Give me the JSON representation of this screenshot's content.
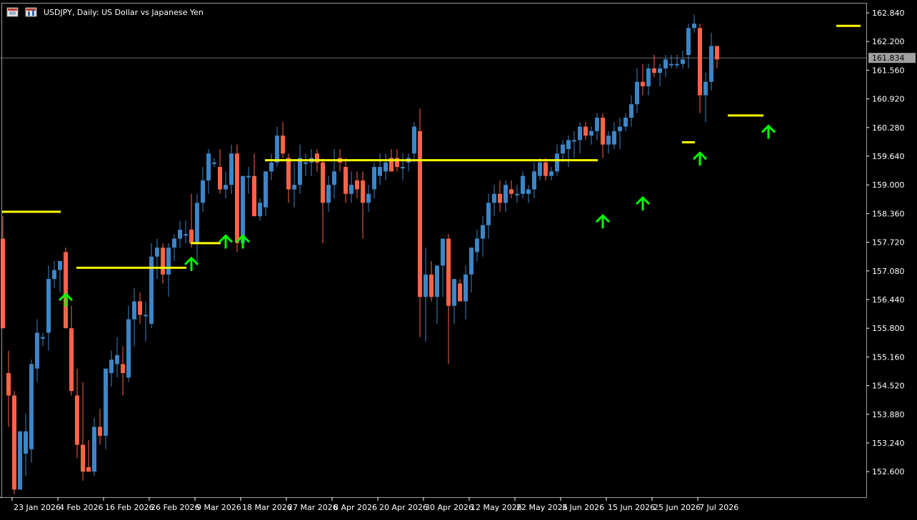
{
  "window": {
    "title": "USDJPY, Daily:  US Dollar vs Japanese Yen"
  },
  "colors": {
    "background": "#000000",
    "bull": "#3d85c6",
    "bear": "#ff6347",
    "level_line": "#ffff00",
    "signal_arrow": "#00ff00",
    "price_line": "#6b6b6b",
    "price_label_bg": "#a0a0a0",
    "axis": "#ffffff"
  },
  "icons": [
    "chart-menu-icon",
    "symbol-properties-icon",
    "up-arrow-icon"
  ],
  "chart_data": {
    "type": "candlestick",
    "symbol": "USDJPY",
    "timeframe": "Daily",
    "description": "US Dollar vs Japanese Yen",
    "current_price": "161.834",
    "ylim": [
      152.1,
      163.0
    ],
    "y_ticks": [
      "162.840",
      "162.200",
      "161.560",
      "160.920",
      "160.280",
      "159.640",
      "159.000",
      "158.360",
      "157.720",
      "157.080",
      "156.440",
      "155.800",
      "155.160",
      "154.520",
      "153.880",
      "153.240",
      "152.600"
    ],
    "x_ticks": [
      "23 Jan 2026",
      "4 Feb 2026",
      "16 Feb 2026",
      "26 Feb 2026",
      "9 Mar 2026",
      "18 Mar 2026",
      "27 Mar 2026",
      "8 Apr 2026",
      "20 Apr 2026",
      "30 Apr 2026",
      "12 May 2026",
      "22 May 2026",
      "3 Jun 2026",
      "15 Jun 2026",
      "25 Jun 2026",
      "7 Jul 2026"
    ],
    "x_tick_bars": [
      2,
      10,
      18,
      26,
      34,
      42,
      50,
      58,
      66,
      74,
      82,
      90,
      98,
      106,
      114,
      122
    ],
    "candles": [
      {
        "o": 157.8,
        "h": 158.3,
        "l": 155.8,
        "c": 155.8
      },
      {
        "o": 154.8,
        "h": 155.3,
        "l": 153.6,
        "c": 154.3
      },
      {
        "o": 154.3,
        "h": 154.4,
        "l": 152.1,
        "c": 152.2
      },
      {
        "o": 152.2,
        "h": 153.5,
        "l": 152.2,
        "c": 153.5
      },
      {
        "o": 153.0,
        "h": 153.9,
        "l": 152.5,
        "c": 153.5
      },
      {
        "o": 153.1,
        "h": 155.1,
        "l": 152.8,
        "c": 155.0
      },
      {
        "o": 154.9,
        "h": 156.0,
        "l": 154.6,
        "c": 155.7
      },
      {
        "o": 155.6,
        "h": 155.7,
        "l": 155.4,
        "c": 155.6
      },
      {
        "o": 155.7,
        "h": 157.2,
        "l": 155.3,
        "c": 156.9
      },
      {
        "o": 156.9,
        "h": 157.3,
        "l": 156.7,
        "c": 157.1
      },
      {
        "o": 157.1,
        "h": 157.3,
        "l": 156.6,
        "c": 157.3
      },
      {
        "o": 157.5,
        "h": 157.6,
        "l": 155.8,
        "c": 155.8
      },
      {
        "o": 155.8,
        "h": 156.3,
        "l": 154.3,
        "c": 154.4
      },
      {
        "o": 154.3,
        "h": 154.9,
        "l": 152.9,
        "c": 153.2
      },
      {
        "o": 153.2,
        "h": 154.6,
        "l": 152.4,
        "c": 152.6
      },
      {
        "o": 152.7,
        "h": 153.3,
        "l": 152.6,
        "c": 152.6
      },
      {
        "o": 152.6,
        "h": 153.8,
        "l": 152.5,
        "c": 153.6
      },
      {
        "o": 153.6,
        "h": 154.0,
        "l": 153.2,
        "c": 153.4
      },
      {
        "o": 153.4,
        "h": 154.8,
        "l": 153.1,
        "c": 154.9
      },
      {
        "o": 154.8,
        "h": 155.3,
        "l": 154.5,
        "c": 155.1
      },
      {
        "o": 155.0,
        "h": 155.6,
        "l": 154.7,
        "c": 155.2
      },
      {
        "o": 155.0,
        "h": 155.4,
        "l": 154.3,
        "c": 154.8
      },
      {
        "o": 154.7,
        "h": 156.3,
        "l": 154.6,
        "c": 156.0
      },
      {
        "o": 156.0,
        "h": 156.7,
        "l": 155.4,
        "c": 156.4
      },
      {
        "o": 156.4,
        "h": 156.6,
        "l": 155.9,
        "c": 156.1
      },
      {
        "o": 156.1,
        "h": 156.4,
        "l": 155.5,
        "c": 156.1
      },
      {
        "o": 155.9,
        "h": 157.7,
        "l": 155.8,
        "c": 157.4
      },
      {
        "o": 157.4,
        "h": 157.8,
        "l": 156.9,
        "c": 157.6
      },
      {
        "o": 157.6,
        "h": 157.7,
        "l": 156.8,
        "c": 157.0
      },
      {
        "o": 157.0,
        "h": 157.7,
        "l": 156.5,
        "c": 157.6
      },
      {
        "o": 157.6,
        "h": 157.9,
        "l": 157.3,
        "c": 157.8
      },
      {
        "o": 157.8,
        "h": 158.2,
        "l": 157.6,
        "c": 158.0
      },
      {
        "o": 157.9,
        "h": 158.2,
        "l": 157.7,
        "c": 157.9
      },
      {
        "o": 158.0,
        "h": 158.8,
        "l": 157.6,
        "c": 157.7
      },
      {
        "o": 157.7,
        "h": 158.8,
        "l": 157.2,
        "c": 158.6
      },
      {
        "o": 158.6,
        "h": 159.4,
        "l": 158.4,
        "c": 159.1
      },
      {
        "o": 159.1,
        "h": 159.8,
        "l": 158.8,
        "c": 159.7
      },
      {
        "o": 159.5,
        "h": 159.6,
        "l": 159.4,
        "c": 159.5
      },
      {
        "o": 159.4,
        "h": 159.8,
        "l": 158.8,
        "c": 158.9
      },
      {
        "o": 158.9,
        "h": 159.3,
        "l": 158.7,
        "c": 159.0
      },
      {
        "o": 159.0,
        "h": 159.9,
        "l": 158.8,
        "c": 159.7
      },
      {
        "o": 159.7,
        "h": 159.9,
        "l": 157.5,
        "c": 157.7
      },
      {
        "o": 157.7,
        "h": 159.1,
        "l": 157.6,
        "c": 159.2
      },
      {
        "o": 159.2,
        "h": 159.4,
        "l": 158.8,
        "c": 159.2
      },
      {
        "o": 159.2,
        "h": 159.7,
        "l": 158.5,
        "c": 158.3
      },
      {
        "o": 158.3,
        "h": 158.7,
        "l": 158.2,
        "c": 158.6
      },
      {
        "o": 158.5,
        "h": 159.3,
        "l": 158.3,
        "c": 159.3
      },
      {
        "o": 159.3,
        "h": 159.7,
        "l": 159.1,
        "c": 159.5
      },
      {
        "o": 159.5,
        "h": 160.3,
        "l": 159.4,
        "c": 160.1
      },
      {
        "o": 160.1,
        "h": 160.4,
        "l": 159.6,
        "c": 159.7
      },
      {
        "o": 159.6,
        "h": 159.7,
        "l": 158.6,
        "c": 158.9
      },
      {
        "o": 158.9,
        "h": 159.5,
        "l": 158.5,
        "c": 159.0
      },
      {
        "o": 159.0,
        "h": 159.9,
        "l": 158.8,
        "c": 159.6
      },
      {
        "o": 159.5,
        "h": 159.7,
        "l": 159.2,
        "c": 159.5
      },
      {
        "o": 159.5,
        "h": 159.8,
        "l": 159.2,
        "c": 159.6
      },
      {
        "o": 159.7,
        "h": 159.8,
        "l": 159.3,
        "c": 159.5
      },
      {
        "o": 159.5,
        "h": 159.6,
        "l": 157.7,
        "c": 158.6
      },
      {
        "o": 158.6,
        "h": 159.2,
        "l": 158.4,
        "c": 159.0
      },
      {
        "o": 159.0,
        "h": 159.8,
        "l": 158.7,
        "c": 159.3
      },
      {
        "o": 159.6,
        "h": 159.8,
        "l": 159.3,
        "c": 159.5
      },
      {
        "o": 159.4,
        "h": 159.6,
        "l": 158.6,
        "c": 158.8
      },
      {
        "o": 158.8,
        "h": 159.3,
        "l": 158.6,
        "c": 159.0
      },
      {
        "o": 159.1,
        "h": 159.3,
        "l": 158.7,
        "c": 158.9
      },
      {
        "o": 159.1,
        "h": 159.3,
        "l": 157.8,
        "c": 158.6
      },
      {
        "o": 158.6,
        "h": 159.0,
        "l": 158.4,
        "c": 158.8
      },
      {
        "o": 158.9,
        "h": 159.5,
        "l": 158.7,
        "c": 159.4
      },
      {
        "o": 159.2,
        "h": 159.7,
        "l": 159.0,
        "c": 159.4
      },
      {
        "o": 159.3,
        "h": 159.7,
        "l": 159.1,
        "c": 159.5
      },
      {
        "o": 159.6,
        "h": 159.8,
        "l": 159.3,
        "c": 159.3
      },
      {
        "o": 159.6,
        "h": 159.8,
        "l": 159.3,
        "c": 159.4
      },
      {
        "o": 159.4,
        "h": 159.7,
        "l": 159.1,
        "c": 159.4
      },
      {
        "o": 159.5,
        "h": 159.7,
        "l": 159.3,
        "c": 159.6
      },
      {
        "o": 159.7,
        "h": 160.4,
        "l": 159.5,
        "c": 160.3
      },
      {
        "o": 160.2,
        "h": 160.7,
        "l": 155.6,
        "c": 156.5
      },
      {
        "o": 156.5,
        "h": 157.6,
        "l": 155.5,
        "c": 157.0
      },
      {
        "o": 157.0,
        "h": 157.3,
        "l": 156.4,
        "c": 156.5
      },
      {
        "o": 156.5,
        "h": 156.8,
        "l": 155.9,
        "c": 157.2
      },
      {
        "o": 157.2,
        "h": 157.4,
        "l": 156.5,
        "c": 157.8
      },
      {
        "o": 157.8,
        "h": 157.9,
        "l": 155.0,
        "c": 156.3
      },
      {
        "o": 156.3,
        "h": 156.9,
        "l": 155.9,
        "c": 156.9
      },
      {
        "o": 156.8,
        "h": 156.9,
        "l": 156.4,
        "c": 156.4
      },
      {
        "o": 156.4,
        "h": 157.2,
        "l": 156.0,
        "c": 157.0
      },
      {
        "o": 157.0,
        "h": 157.3,
        "l": 156.6,
        "c": 157.6
      },
      {
        "o": 157.5,
        "h": 158.0,
        "l": 157.3,
        "c": 157.8
      },
      {
        "o": 157.8,
        "h": 158.3,
        "l": 157.4,
        "c": 158.1
      },
      {
        "o": 158.1,
        "h": 158.8,
        "l": 157.8,
        "c": 158.6
      },
      {
        "o": 158.6,
        "h": 159.0,
        "l": 158.3,
        "c": 158.8
      },
      {
        "o": 158.8,
        "h": 159.1,
        "l": 158.4,
        "c": 158.6
      },
      {
        "o": 158.6,
        "h": 159.1,
        "l": 158.4,
        "c": 159.0
      },
      {
        "o": 158.9,
        "h": 159.1,
        "l": 158.7,
        "c": 158.8
      },
      {
        "o": 158.8,
        "h": 159.0,
        "l": 158.6,
        "c": 158.8
      },
      {
        "o": 158.8,
        "h": 159.3,
        "l": 158.7,
        "c": 159.2
      },
      {
        "o": 158.8,
        "h": 159.0,
        "l": 158.6,
        "c": 158.9
      },
      {
        "o": 158.9,
        "h": 159.5,
        "l": 158.7,
        "c": 159.3
      },
      {
        "o": 159.2,
        "h": 159.6,
        "l": 159.1,
        "c": 159.5
      },
      {
        "o": 159.5,
        "h": 159.6,
        "l": 159.1,
        "c": 159.2
      },
      {
        "o": 159.2,
        "h": 159.4,
        "l": 159.1,
        "c": 159.3
      },
      {
        "o": 159.3,
        "h": 159.9,
        "l": 159.2,
        "c": 159.7
      },
      {
        "o": 159.7,
        "h": 160.0,
        "l": 159.5,
        "c": 159.9
      },
      {
        "o": 159.8,
        "h": 160.1,
        "l": 159.4,
        "c": 160.0
      },
      {
        "o": 160.0,
        "h": 160.2,
        "l": 159.6,
        "c": 160.0
      },
      {
        "o": 160.0,
        "h": 160.4,
        "l": 159.7,
        "c": 160.3
      },
      {
        "o": 160.3,
        "h": 160.4,
        "l": 160.0,
        "c": 160.1
      },
      {
        "o": 160.1,
        "h": 160.3,
        "l": 159.9,
        "c": 160.2
      },
      {
        "o": 160.2,
        "h": 160.6,
        "l": 160.0,
        "c": 160.5
      },
      {
        "o": 160.5,
        "h": 160.6,
        "l": 159.6,
        "c": 159.9
      },
      {
        "o": 159.9,
        "h": 160.2,
        "l": 159.7,
        "c": 160.1
      },
      {
        "o": 159.9,
        "h": 160.4,
        "l": 159.8,
        "c": 160.2
      },
      {
        "o": 160.2,
        "h": 160.5,
        "l": 159.8,
        "c": 160.3
      },
      {
        "o": 160.3,
        "h": 160.6,
        "l": 160.2,
        "c": 160.5
      },
      {
        "o": 160.5,
        "h": 161.0,
        "l": 160.3,
        "c": 160.8
      },
      {
        "o": 160.8,
        "h": 161.6,
        "l": 160.6,
        "c": 161.3
      },
      {
        "o": 161.3,
        "h": 161.7,
        "l": 161.0,
        "c": 161.2
      },
      {
        "o": 161.2,
        "h": 161.7,
        "l": 161.0,
        "c": 161.6
      },
      {
        "o": 161.6,
        "h": 161.9,
        "l": 161.4,
        "c": 161.5
      },
      {
        "o": 161.5,
        "h": 161.7,
        "l": 161.2,
        "c": 161.6
      },
      {
        "o": 161.6,
        "h": 161.9,
        "l": 161.4,
        "c": 161.8
      },
      {
        "o": 161.7,
        "h": 161.9,
        "l": 161.6,
        "c": 161.7
      },
      {
        "o": 161.7,
        "h": 161.9,
        "l": 161.6,
        "c": 161.7
      },
      {
        "o": 161.7,
        "h": 162.0,
        "l": 161.6,
        "c": 161.8
      },
      {
        "o": 161.9,
        "h": 162.6,
        "l": 161.6,
        "c": 162.5
      },
      {
        "o": 162.5,
        "h": 162.8,
        "l": 162.4,
        "c": 162.6
      },
      {
        "o": 162.5,
        "h": 162.6,
        "l": 160.6,
        "c": 161.0
      },
      {
        "o": 161.0,
        "h": 161.5,
        "l": 160.4,
        "c": 161.3
      },
      {
        "o": 161.3,
        "h": 162.4,
        "l": 161.1,
        "c": 162.1
      },
      {
        "o": 162.1,
        "h": 162.1,
        "l": 161.6,
        "c": 161.8
      }
    ],
    "levels": [
      {
        "price": 158.4,
        "from": 0,
        "to": 10
      },
      {
        "price": 157.15,
        "from": 13,
        "to": 32
      },
      {
        "price": 157.7,
        "from": 33,
        "to": 38
      },
      {
        "price": 159.55,
        "from": 46,
        "to": 104
      },
      {
        "price": 159.95,
        "from": 119,
        "to": 121
      },
      {
        "price": 160.55,
        "from": 127,
        "to": 133
      },
      {
        "price": 162.55,
        "from": 146,
        "to": 150
      }
    ],
    "up_arrows": [
      {
        "bar": 11,
        "price": 156.55
      },
      {
        "bar": 33,
        "price": 157.35
      },
      {
        "bar": 39,
        "price": 157.85
      },
      {
        "bar": 42,
        "price": 157.85
      },
      {
        "bar": 105,
        "price": 158.3
      },
      {
        "bar": 112,
        "price": 158.7
      },
      {
        "bar": 122,
        "price": 159.7
      },
      {
        "bar": 134,
        "price": 160.3
      }
    ]
  }
}
